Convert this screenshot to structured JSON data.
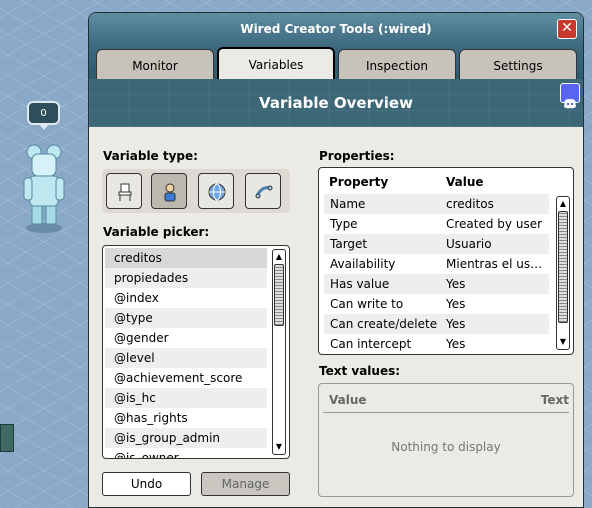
{
  "room": {
    "bubble_count": "0"
  },
  "window": {
    "title": "Wired Creator Tools (:wired)",
    "close_symbol": "✕"
  },
  "tabs": [
    {
      "label": "Monitor",
      "active": false
    },
    {
      "label": "Variables",
      "active": true
    },
    {
      "label": "Inspection",
      "active": false
    },
    {
      "label": "Settings",
      "active": false
    }
  ],
  "banner": {
    "title": "Variable Overview"
  },
  "variable_type": {
    "label": "Variable type:",
    "buttons": [
      {
        "icon": "furniture-chair-icon",
        "active": false
      },
      {
        "icon": "user-avatar-icon",
        "active": true
      },
      {
        "icon": "globe-icon",
        "active": false
      },
      {
        "icon": "context-link-icon",
        "active": false
      }
    ]
  },
  "variable_picker": {
    "label": "Variable picker:",
    "items": [
      "creditos",
      "propiedades",
      "@index",
      "@type",
      "@gender",
      "@level",
      "@achievement_score",
      "@is_hc",
      "@has_rights",
      "@is_group_admin",
      "@is_owner"
    ],
    "selected_index": 0
  },
  "buttons": {
    "undo": "Undo",
    "manage": "Manage"
  },
  "properties": {
    "label": "Properties:",
    "col_property": "Property",
    "col_value": "Value",
    "rows": [
      {
        "k": "Name",
        "v": "creditos"
      },
      {
        "k": "Type",
        "v": "Created by user"
      },
      {
        "k": "Target",
        "v": "Usuario"
      },
      {
        "k": "Availability",
        "v": "Mientras el usuario"
      },
      {
        "k": "Has value",
        "v": "Yes"
      },
      {
        "k": "Can write to",
        "v": "Yes"
      },
      {
        "k": "Can create/delete",
        "v": "Yes"
      },
      {
        "k": "Can intercept",
        "v": "Yes"
      }
    ]
  },
  "text_values": {
    "label": "Text values:",
    "col_value": "Value",
    "col_text": "Text",
    "empty": "Nothing to display"
  }
}
